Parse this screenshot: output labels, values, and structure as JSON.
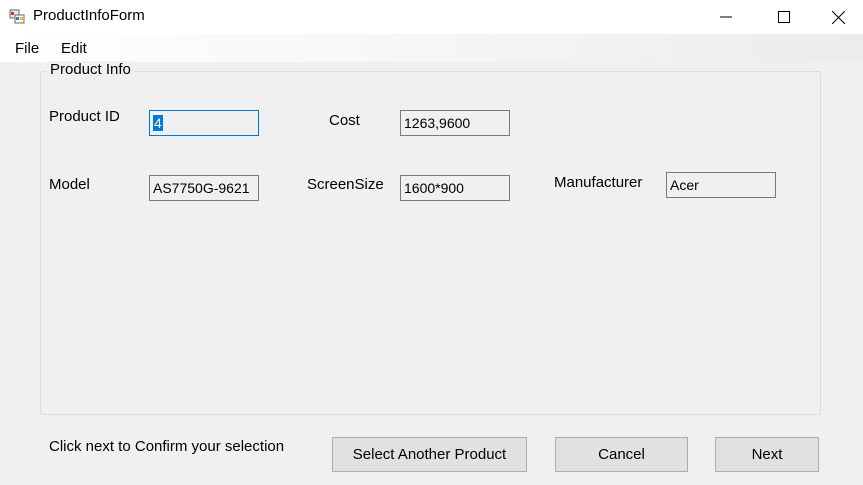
{
  "window": {
    "title": "ProductInfoForm",
    "controls": {
      "minimize_icon": "minimize-icon",
      "maximize_icon": "maximize-icon",
      "close_icon": "close-icon"
    }
  },
  "menu": {
    "file": "File",
    "edit": "Edit"
  },
  "group": {
    "legend": "Product Info"
  },
  "fields": {
    "product_id": {
      "label": "Product ID",
      "value": "4"
    },
    "cost": {
      "label": "Cost",
      "value": "1263,9600"
    },
    "model": {
      "label": "Model",
      "value": "AS7750G-9621"
    },
    "screen_size": {
      "label": "ScreenSize",
      "value": "1600*900"
    },
    "manufacturer": {
      "label": "Manufacturer",
      "value": "Acer"
    }
  },
  "footer": {
    "instruction": "Click next to Confirm your selection",
    "select_another": "Select Another Product",
    "cancel": "Cancel",
    "next": "Next"
  },
  "colors": {
    "selection": "#0078d7",
    "button_bg": "#e1e1e1",
    "window_bg": "#f0f0f0"
  }
}
